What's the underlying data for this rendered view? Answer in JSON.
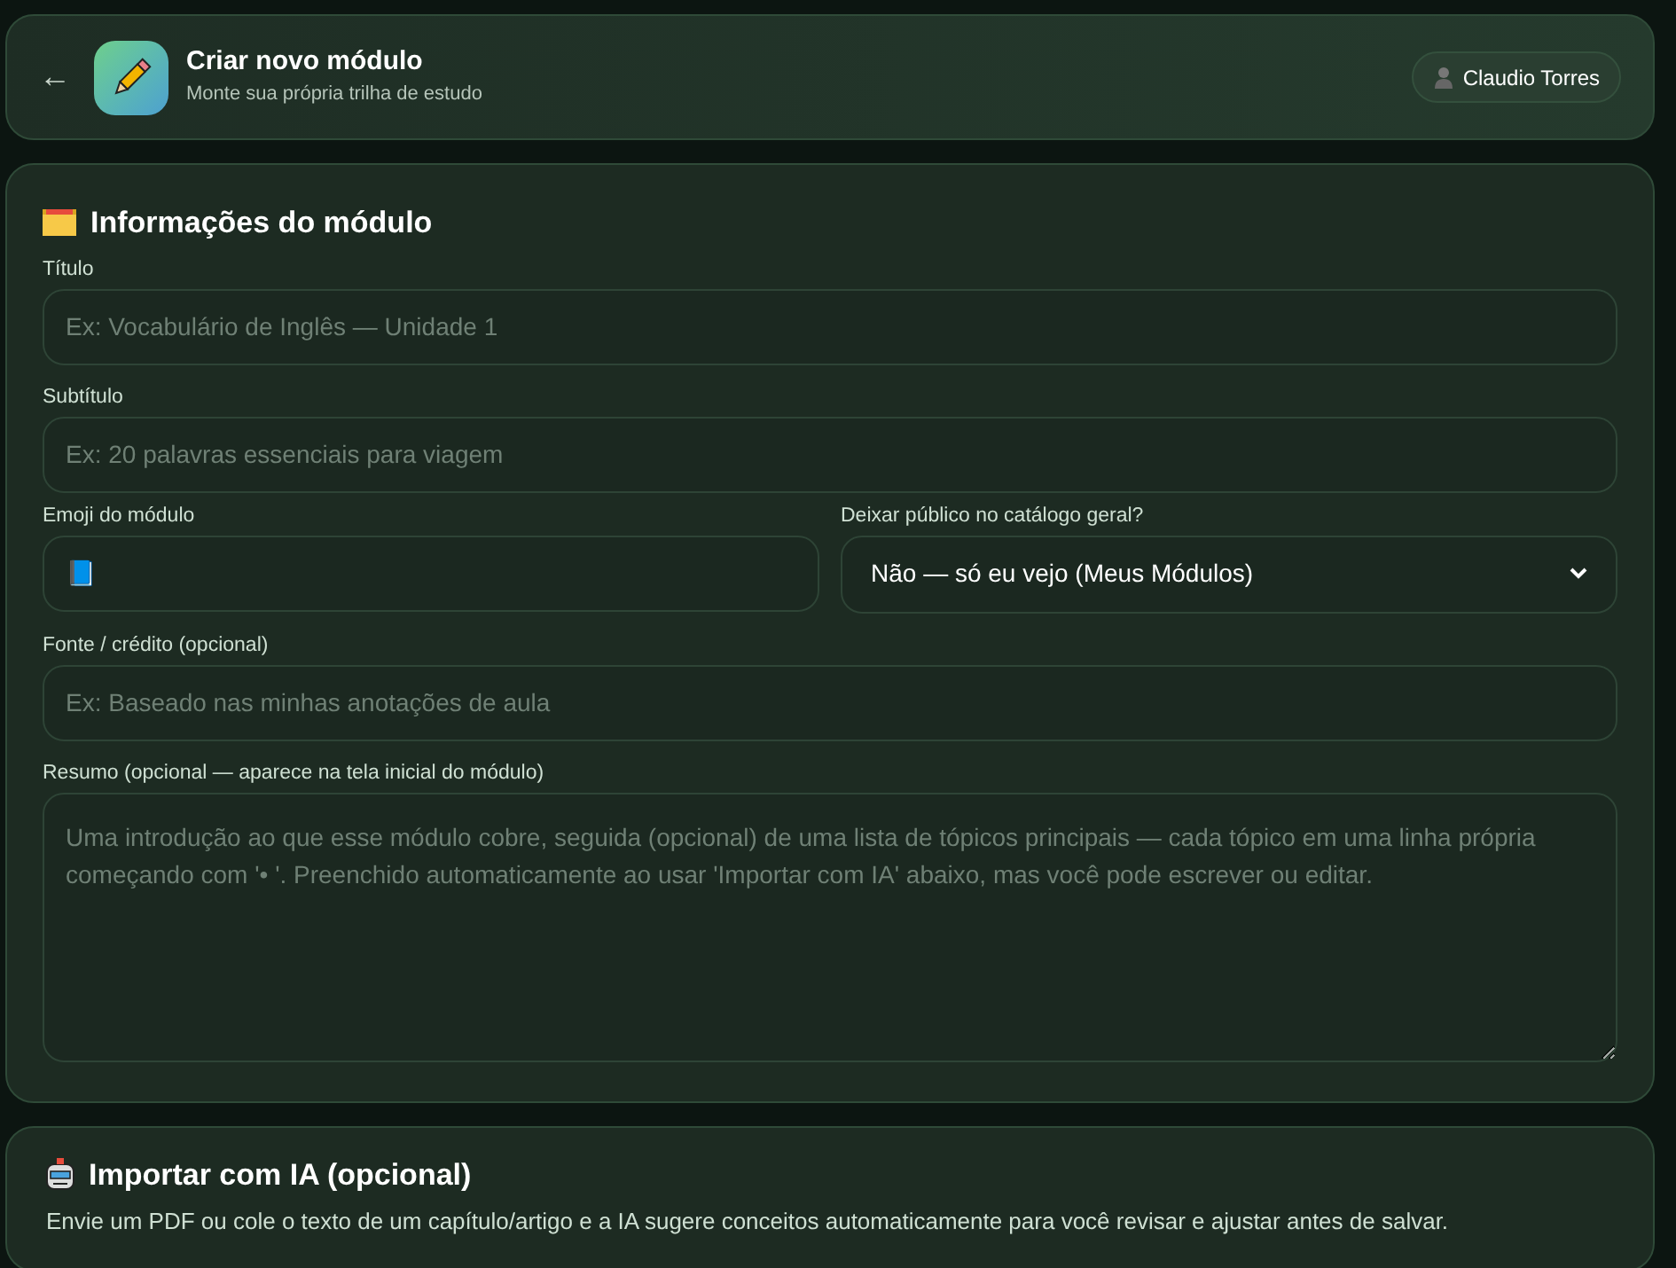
{
  "header": {
    "back": "←",
    "title": "Criar novo módulo",
    "subtitle": "Monte sua própria trilha de estudo",
    "user": "Claudio Torres"
  },
  "info_section": {
    "title": "Informações do módulo",
    "fields": [
      {
        "kind": "text",
        "label": "Título",
        "placeholder": "Ex: Vocabulário de Inglês — Unidade 1"
      },
      {
        "kind": "text",
        "label": "Subtítulo",
        "placeholder": "Ex: 20 palavras essenciais para viagem"
      },
      {
        "kind": "pair",
        "items": [
          {
            "kind": "text",
            "label": "Emoji do módulo",
            "value": "📘"
          },
          {
            "kind": "select",
            "label": "Deixar público no catálogo geral?",
            "value": "Não — só eu vejo (Meus Módulos)"
          }
        ]
      },
      {
        "kind": "text",
        "label": "Fonte / crédito (opcional)",
        "placeholder": "Ex: Baseado nas minhas anotações de aula"
      },
      {
        "kind": "textarea",
        "label": "Resumo (opcional — aparece na tela inicial do módulo)",
        "placeholder": "Uma introdução ao que esse módulo cobre, seguida (opcional) de uma lista de tópicos principais — cada tópico em uma linha própria começando com '• '. Preenchido automaticamente ao usar 'Importar com IA' abaixo, mas você pode escrever ou editar."
      }
    ]
  },
  "import_section": {
    "title": "Importar com IA (opcional)",
    "description": "Envie um PDF ou cole o texto de um capítulo/artigo e a IA sugere conceitos automaticamente para você revisar e ajustar antes de salvar."
  }
}
